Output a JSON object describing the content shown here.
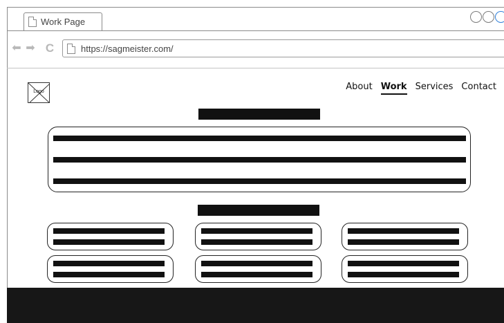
{
  "browser": {
    "tab": {
      "title": "Work Page"
    },
    "address_bar": {
      "url": "https://sagmeister.com/"
    },
    "window_controls": [
      "minimize",
      "maximize",
      "close"
    ],
    "nav_icons": [
      "back-arrow-icon",
      "forward-arrow-icon",
      "reload-icon"
    ]
  },
  "site": {
    "logo": {
      "label": "Logo"
    },
    "nav": {
      "items": [
        {
          "label": "About"
        },
        {
          "label": "Work",
          "active": true
        },
        {
          "label": "Services"
        },
        {
          "label": "Contact"
        }
      ]
    }
  },
  "colors": {
    "placeholder_fill": "#111111",
    "footer_bg": "#171717",
    "chrome_border": "#8a8a8a",
    "window_control_accent": "#2f7fd9"
  }
}
